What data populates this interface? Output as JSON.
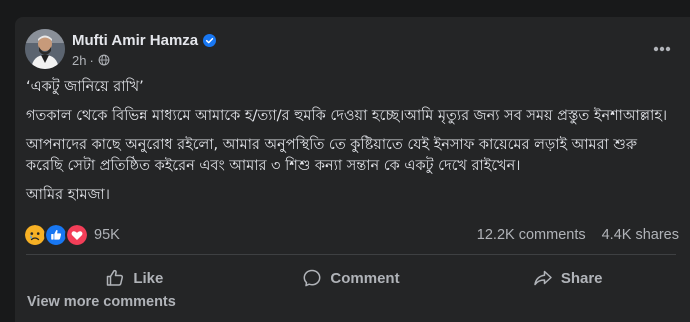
{
  "post": {
    "author": "Mufti Amir Hamza",
    "time": "2h",
    "dot": "·",
    "paragraphs": [
      "‘একটু জানিয়ে রাখি’",
      "গতকাল থেকে বিভিন্ন মাধ্যমে আমাকে হ/ত্যা/র হুমকি দেওয়া হচ্ছে।আমি মৃত্যুর জন্য সব সময় প্রস্তুত ইনশাআল্লাহ।",
      "আপনাদের কাছে অনুরোধ রইলো, আমার অনুপস্থিতি তে কুষ্টিয়াতে যেই ইনসাফ কায়েমের লড়াই আমরা শুরু করেছি সেটা প্রতিষ্ঠিত কইরেন এবং আমার ৩ শিশু কন্যা সন্তান কে একটু দেখে রাইখেন।",
      "আমির হামজা।"
    ],
    "reactions": {
      "icons": [
        "sad-react-icon",
        "like-react-icon",
        "love-react-icon"
      ],
      "count": "95K"
    },
    "comments_count": "12.2K comments",
    "shares_count": "4.4K shares"
  },
  "actions": {
    "like": "Like",
    "comment": "Comment",
    "share": "Share"
  },
  "view_more_comments": "View more comments",
  "colors": {
    "page_bg": "#18191a",
    "card_bg": "#242526",
    "primary_text": "#e4e6eb",
    "secondary_text": "#b0b3b8",
    "verified_blue": "#1877f2",
    "love_red": "#f33e58",
    "sad_yellow": "#f7b125"
  }
}
